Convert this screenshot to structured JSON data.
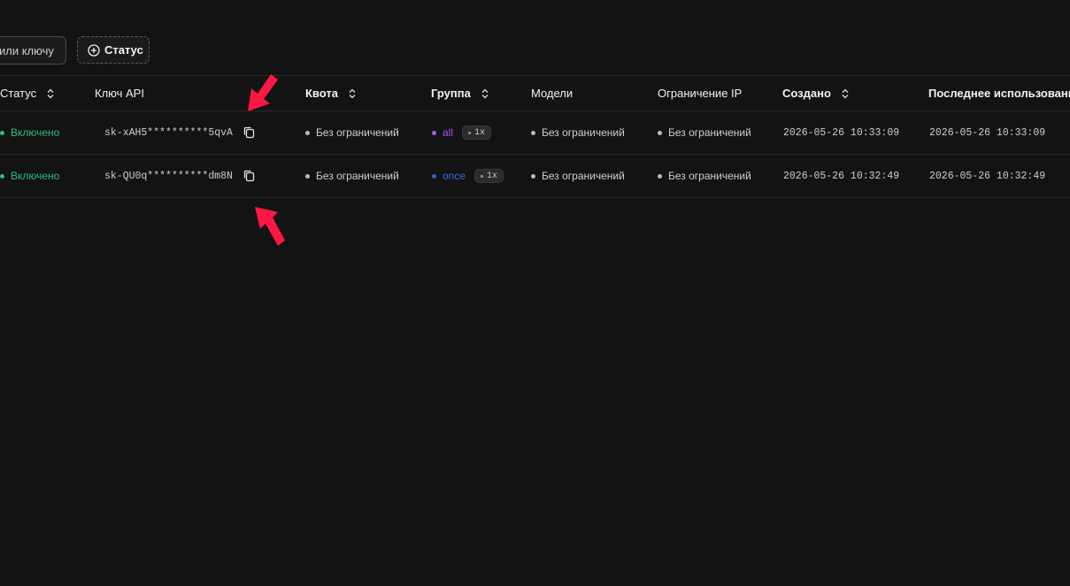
{
  "toolbar": {
    "search_placeholder": "или ключу",
    "status_filter_label": "Статус"
  },
  "table": {
    "headers": {
      "status": "Статус",
      "api_key": "Ключ API",
      "quota": "Квота",
      "group": "Группа",
      "models": "Модели",
      "ip_limit": "Ограничение IP",
      "created": "Создано",
      "last_used": "Последнее использование"
    },
    "rows": [
      {
        "status": "Включено",
        "key": "sk-xAH5**********5qvA",
        "quota": "Без ограничений",
        "group": "all",
        "group_color": "#a855f7",
        "ratio": "1x",
        "models": "Без ограничений",
        "ip_limit": "Без ограничений",
        "created": "2026-05-26 10:33:09",
        "last_used": "2026-05-26 10:33:09"
      },
      {
        "status": "Включено",
        "key": "sk-QU0q**********dm8N",
        "quota": "Без ограничений",
        "group": "once",
        "group_color": "#3b5bdb",
        "ratio": "1x",
        "models": "Без ограничений",
        "ip_limit": "Без ограничений",
        "created": "2026-05-26 10:32:49",
        "last_used": "2026-05-26 10:32:49"
      }
    ]
  },
  "colors": {
    "background": "#131313",
    "enabled_status": "#27c17b",
    "annotation_arrow": "#ff1744"
  },
  "icons": {
    "filter_add": "plus-circle-icon",
    "sort": "chevron-up-down-icon",
    "copy": "copy-icon",
    "annotation": "red-arrow-icon"
  }
}
